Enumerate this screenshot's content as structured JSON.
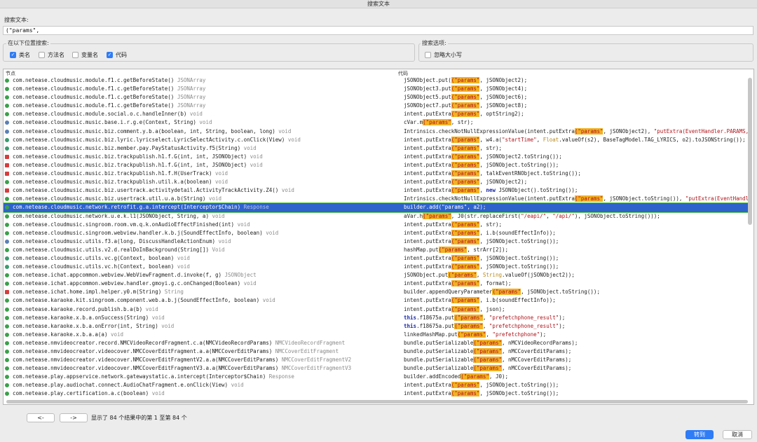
{
  "window": {
    "title": "搜索文本"
  },
  "search": {
    "label": "搜索文本:",
    "value": "(\"params\","
  },
  "scope": {
    "label": "在以下位置搜索:",
    "options": [
      {
        "label": "类名",
        "checked": true
      },
      {
        "label": "方法名",
        "checked": false
      },
      {
        "label": "变量名",
        "checked": false
      },
      {
        "label": "代码",
        "checked": true
      }
    ]
  },
  "search_options": {
    "label": "搜索选项:",
    "ignore_case": {
      "label": "忽略大小写",
      "checked": false
    }
  },
  "table": {
    "columns": {
      "node": "节点",
      "code": "代码"
    },
    "rows": [
      {
        "node": "com.netease.cloudmusic.module.f1.c.getBeforeState()",
        "ret": "JSONArray",
        "code": [
          [
            "",
            "jSONObject.put("
          ],
          [
            "h",
            "(\"params\""
          ],
          [
            "",
            ", jSONObject2);"
          ]
        ],
        "icon": "green"
      },
      {
        "node": "com.netease.cloudmusic.module.f1.c.getBeforeState()",
        "ret": "JSONArray",
        "code": [
          [
            "",
            "jSONObject3.put"
          ],
          [
            "h",
            "(\"params\""
          ],
          [
            "",
            ", jSONObject4);"
          ]
        ],
        "icon": "green"
      },
      {
        "node": "com.netease.cloudmusic.module.f1.c.getBeforeState()",
        "ret": "JSONArray",
        "code": [
          [
            "",
            "jSONObject5.put"
          ],
          [
            "h",
            "(\"params\""
          ],
          [
            "",
            ", jSONObject6);"
          ]
        ],
        "icon": "green"
      },
      {
        "node": "com.netease.cloudmusic.module.f1.c.getBeforeState()",
        "ret": "JSONArray",
        "code": [
          [
            "",
            "jSONObject7.put"
          ],
          [
            "h",
            "(\"params\""
          ],
          [
            "",
            ", jSONObject8);"
          ]
        ],
        "icon": "green"
      },
      {
        "node": "com.netease.cloudmusic.module.social.o.c.handleInner(b)",
        "ret": "void",
        "code": [
          [
            "",
            "intent.putExtra"
          ],
          [
            "h",
            "(\"params\""
          ],
          [
            "",
            ", optString2);"
          ]
        ],
        "icon": "green"
      },
      {
        "node": "com.netease.cloudmusic.music.base.i.r.g.e(Context, String)",
        "ret": "void",
        "code": [
          [
            "",
            "cVar.m"
          ],
          [
            "h",
            "(\"params\""
          ],
          [
            "",
            ", str);"
          ]
        ],
        "icon": "gear"
      },
      {
        "node": "com.netease.cloudmusic.music.biz.comment.y.b.a(boolean, int, String, boolean, long)",
        "ret": "void",
        "code": [
          [
            "",
            "Intrinsics.checkNotNullExpressionValue(intent.putExtra"
          ],
          [
            "h",
            "(\"params\""
          ],
          [
            "",
            ", jSONObject2), "
          ],
          [
            "s",
            "\"putExtra(EventHandler.PARAMS,"
          ]
        ],
        "icon": "gear"
      },
      {
        "node": "com.netease.cloudmusic.music.biz.lyric.lyricselect.LyricSelectActivity.c.onClick(View)",
        "ret": "void",
        "code": [
          [
            "",
            "intent.putExtra"
          ],
          [
            "h",
            "(\"params\""
          ],
          [
            "",
            ", w4.a("
          ],
          [
            "s",
            "\"startTime\""
          ],
          [
            "",
            ", "
          ],
          [
            "f",
            "Float"
          ],
          [
            "",
            ".valueOf(s2), BaseTagModel.TAG_LYRICS, o2).toJSONString());"
          ]
        ],
        "icon": "pen"
      },
      {
        "node": "com.netease.cloudmusic.music.biz.member.pay.PayStatusActivity.f5(String)",
        "ret": "void",
        "code": [
          [
            "",
            "intent.putExtra"
          ],
          [
            "h",
            "(\"params\""
          ],
          [
            "",
            ", str);"
          ]
        ],
        "icon": "pen"
      },
      {
        "node": "com.netease.cloudmusic.music.biz.trackpublish.h1.f.G(int, int, JSONObject)",
        "ret": "void",
        "code": [
          [
            "",
            "intent.putExtra"
          ],
          [
            "h",
            "(\"params\""
          ],
          [
            "",
            ", jSONObject2.toString());"
          ]
        ],
        "icon": "lock"
      },
      {
        "node": "com.netease.cloudmusic.music.biz.trackpublish.h1.f.G(int, int, JSONObject)",
        "ret": "void",
        "code": [
          [
            "",
            "intent.putExtra"
          ],
          [
            "h",
            "(\"params\""
          ],
          [
            "",
            ", jSONObject.toString());"
          ]
        ],
        "icon": "lock"
      },
      {
        "node": "com.netease.cloudmusic.music.biz.trackpublish.h1.f.H(UserTrack)",
        "ret": "void",
        "code": [
          [
            "",
            "intent.putExtra"
          ],
          [
            "h",
            "(\"params\""
          ],
          [
            "",
            ", talkEventRNObject.toString());"
          ]
        ],
        "icon": "lock"
      },
      {
        "node": "com.netease.cloudmusic.music.biz.trackpublish.util.k.a(boolean)",
        "ret": "void",
        "code": [
          [
            "",
            "intent.putExtra"
          ],
          [
            "h",
            "(\"params\""
          ],
          [
            "",
            ", jSONObject2);"
          ]
        ],
        "icon": "green"
      },
      {
        "node": "com.netease.cloudmusic.music.biz.usertrack.activitydetail.ActivityTrackActivity.Z4()",
        "ret": "void",
        "code": [
          [
            "",
            "intent.putExtra"
          ],
          [
            "h",
            "(\"params\""
          ],
          [
            "",
            ", "
          ],
          [
            "k",
            "new"
          ],
          [
            "",
            " JSONObject().toString());"
          ]
        ],
        "icon": "red"
      },
      {
        "node": "com.netease.cloudmusic.music.biz.usertrack.util.u.a.b(String)",
        "ret": "void",
        "code": [
          [
            "",
            "Intrinsics.checkNotNullExpressionValue(intent.putExtra"
          ],
          [
            "h",
            "(\"params\""
          ],
          [
            "",
            ", jSONObject.toString()), "
          ],
          [
            "s",
            "\"putExtra(EventHandle"
          ]
        ],
        "icon": "green"
      },
      {
        "node": "com.netease.cloudmusic.network.retrofit.g.a.intercept(Interceptor$Chain)",
        "ret": "Response",
        "code": [
          [
            "",
            "builder.add"
          ],
          [
            "h",
            "(\"params\""
          ],
          [
            "",
            ", a2);"
          ]
        ],
        "icon": "green",
        "selected": true
      },
      {
        "node": "com.netease.cloudmusic.network.u.e.k.l1(JSONObject, String, a)",
        "ret": "void",
        "code": [
          [
            "",
            "aVar.h"
          ],
          [
            "h",
            "(\"params\""
          ],
          [
            "",
            ", J0(str.replaceFirst("
          ],
          [
            "s",
            "\"/eapi/\""
          ],
          [
            "",
            ", "
          ],
          [
            "s",
            "\"/api/\""
          ],
          [
            "",
            "), jSONObject.toString()));"
          ]
        ],
        "icon": "green"
      },
      {
        "node": "com.netease.cloudmusic.singroom.room.vm.q.k.onAudioEffectFinished(int)",
        "ret": "void",
        "code": [
          [
            "",
            "intent.putExtra"
          ],
          [
            "h",
            "(\"params\""
          ],
          [
            "",
            ", str);"
          ]
        ],
        "icon": "green"
      },
      {
        "node": "com.netease.cloudmusic.singroom.webview.handler.k.b.j(SoundEffectInfo, boolean)",
        "ret": "void",
        "code": [
          [
            "",
            "intent.putExtra"
          ],
          [
            "h",
            "(\"params\""
          ],
          [
            "",
            ", i.b(soundEffectInfo));"
          ]
        ],
        "icon": "green"
      },
      {
        "node": "com.netease.cloudmusic.utils.f3.a(long, DiscussHandleActionEnum)",
        "ret": "void",
        "code": [
          [
            "",
            "intent.putExtra"
          ],
          [
            "h",
            "(\"params\""
          ],
          [
            "",
            ", jSONObject.toString());"
          ]
        ],
        "icon": "gear"
      },
      {
        "node": "com.netease.cloudmusic.utils.v2.d.realDoInBackground(String[])",
        "ret": "Void",
        "code": [
          [
            "",
            "hashMap.put"
          ],
          [
            "h",
            "(\"params\""
          ],
          [
            "",
            ", strArr[2]);"
          ]
        ],
        "icon": "green"
      },
      {
        "node": "com.netease.cloudmusic.utils.vc.g(Context, boolean)",
        "ret": "void",
        "code": [
          [
            "",
            "intent.putExtra"
          ],
          [
            "h",
            "(\"params\""
          ],
          [
            "",
            ", jSONObject.toString());"
          ]
        ],
        "icon": "pen"
      },
      {
        "node": "com.netease.cloudmusic.utils.vc.h(Context, boolean)",
        "ret": "void",
        "code": [
          [
            "",
            "intent.putExtra"
          ],
          [
            "h",
            "(\"params\""
          ],
          [
            "",
            ", jSONObject.toString());"
          ]
        ],
        "icon": "pen"
      },
      {
        "node": "com.netease.ichat.appcommon.webview.WebViewFragment.d.invoke(f, g)",
        "ret": "JSONObject",
        "code": [
          [
            "",
            "jSONObject.put"
          ],
          [
            "h",
            "(\"params\""
          ],
          [
            "",
            ", "
          ],
          [
            "f",
            "String"
          ],
          [
            "",
            ".valueOf(jSONObject2));"
          ]
        ],
        "icon": "green"
      },
      {
        "node": "com.netease.ichat.appcommon.webview.handler.gmoyi.g.c.onChanged(Boolean)",
        "ret": "void",
        "code": [
          [
            "",
            "intent.putExtra"
          ],
          [
            "h",
            "(\"params\""
          ],
          [
            "",
            ", format);"
          ]
        ],
        "icon": "green"
      },
      {
        "node": "com.netease.ichat.home.impl.helper.y0.m(String)",
        "ret": "String",
        "code": [
          [
            "",
            "builder.appendQueryParameter"
          ],
          [
            "h",
            "(\"params\""
          ],
          [
            "",
            ", jSONObject.toString());"
          ]
        ],
        "icon": "lock"
      },
      {
        "node": "com.netease.karaoke.kit.singroom.component.web.a.b.j(SoundEffectInfo, boolean)",
        "ret": "void",
        "code": [
          [
            "",
            "intent.putExtra"
          ],
          [
            "h",
            "(\"params\""
          ],
          [
            "",
            ", i.b(soundEffectInfo));"
          ]
        ],
        "icon": "green"
      },
      {
        "node": "com.netease.karaoke.record.publish.b.a(b)",
        "ret": "void",
        "code": [
          [
            "",
            "intent.putExtra"
          ],
          [
            "h",
            "(\"params\""
          ],
          [
            "",
            ", json);"
          ]
        ],
        "icon": "green"
      },
      {
        "node": "com.netease.karaoke.x.b.a.onSuccess(String)",
        "ret": "void",
        "code": [
          [
            "k",
            "this"
          ],
          [
            "",
            ".f18675a.put"
          ],
          [
            "h",
            "(\"params\""
          ],
          [
            "",
            ", "
          ],
          [
            "s",
            "\"prefetchphone_result\""
          ],
          [
            "",
            ");"
          ]
        ],
        "icon": "green"
      },
      {
        "node": "com.netease.karaoke.x.b.a.onError(int, String)",
        "ret": "void",
        "code": [
          [
            "k",
            "this"
          ],
          [
            "",
            ".f18675a.put"
          ],
          [
            "h",
            "(\"params\""
          ],
          [
            "",
            ", "
          ],
          [
            "s",
            "\"prefetchphone_result\""
          ],
          [
            "",
            ");"
          ]
        ],
        "icon": "green"
      },
      {
        "node": "com.netease.karaoke.x.b.a.a(a)",
        "ret": "void",
        "code": [
          [
            "",
            "linkedHashMap.put"
          ],
          [
            "h",
            "(\"params\""
          ],
          [
            "",
            ", "
          ],
          [
            "s",
            "\"prefetchphone\""
          ],
          [
            "",
            ");"
          ]
        ],
        "icon": "green"
      },
      {
        "node": "com.netease.nmvideocreator.record.NMCVideoRecordFragment.c.a(NMCVideoRecordParams)",
        "ret": "NMCVideoRecordFragment",
        "code": [
          [
            "",
            "bundle.putSerializable"
          ],
          [
            "h",
            "(\"params\""
          ],
          [
            "",
            ", nMCVideoRecordParams);"
          ]
        ],
        "icon": "green"
      },
      {
        "node": "com.netease.nmvideocreator.videocover.NMCCoverEditFragment.a.a(NMCCoverEditParams)",
        "ret": "NMCCoverEditFragment",
        "code": [
          [
            "",
            "bundle.putSerializable"
          ],
          [
            "h",
            "(\"params\""
          ],
          [
            "",
            ", nMCCoverEditParams);"
          ]
        ],
        "icon": "green"
      },
      {
        "node": "com.netease.nmvideocreator.videocover.NMCCoverEditFragmentV2.a.a(NMCCoverEditParams)",
        "ret": "NMCCoverEditFragmentV2",
        "code": [
          [
            "",
            "bundle.putSerializable"
          ],
          [
            "h",
            "(\"params\""
          ],
          [
            "",
            ", nMCCoverEditParams);"
          ]
        ],
        "icon": "green"
      },
      {
        "node": "com.netease.nmvideocreator.videocover.NMCCoverEditFragmentV3.a.a(NMCCoverEditParams)",
        "ret": "NMCCoverEditFragmentV3",
        "code": [
          [
            "",
            "bundle.putSerializable"
          ],
          [
            "h",
            "(\"params\""
          ],
          [
            "",
            ", nMCCoverEditParams);"
          ]
        ],
        "icon": "green"
      },
      {
        "node": "com.netease.play.appservice.network.gatewaystatic.a.intercept(Interceptor$Chain)",
        "ret": "Response",
        "code": [
          [
            "",
            "builder.addEncoded"
          ],
          [
            "h",
            "(\"params\""
          ],
          [
            "",
            ", J0);"
          ]
        ],
        "icon": "green"
      },
      {
        "node": "com.netease.play.audiochat.connect.AudioChatFragment.e.onClick(View)",
        "ret": "void",
        "code": [
          [
            "",
            "intent.putExtra"
          ],
          [
            "h",
            "(\"params\""
          ],
          [
            "",
            ", jSONObject.toString());"
          ]
        ],
        "icon": "green"
      },
      {
        "node": "com.netease.play.certification.a.c(boolean)",
        "ret": "void",
        "code": [
          [
            "",
            "intent.putExtra"
          ],
          [
            "h",
            "(\"params\""
          ],
          [
            "",
            ", jSONObject.toString());"
          ]
        ],
        "icon": "green"
      }
    ]
  },
  "pager": {
    "prev_label": "<-",
    "next_label": "->",
    "status": "显示了 84 个结果中的第 1 至第 84 个"
  },
  "buttons": {
    "goto_label": "转到",
    "cancel_label": "取消"
  },
  "colors": {
    "accent": "#2f7cf6",
    "selection": "#2e63cc",
    "highlight": "#f2b125",
    "string": "#b0131a"
  }
}
